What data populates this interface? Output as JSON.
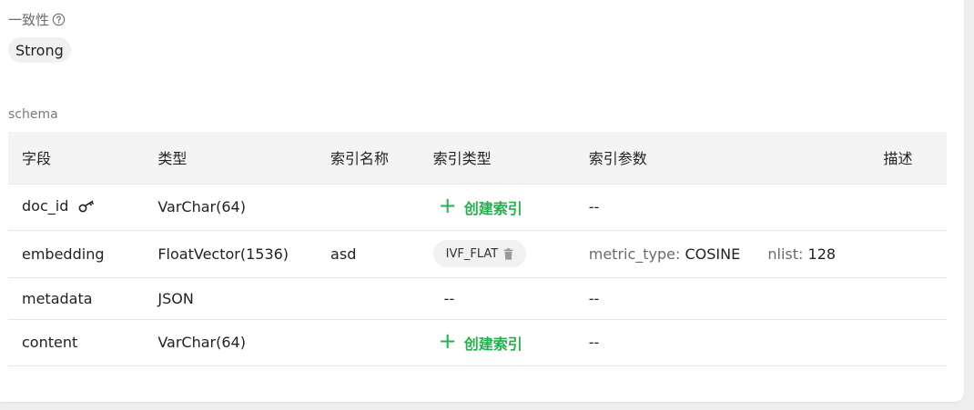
{
  "consistency": {
    "label": "一致性",
    "value": "Strong"
  },
  "schema": {
    "label": "schema",
    "headers": [
      "字段",
      "类型",
      "索引名称",
      "索引类型",
      "索引参数",
      "描述"
    ],
    "rows": [
      {
        "field": "doc_id",
        "type": "VarChar(64)",
        "index_name": "",
        "index_type": "",
        "create_index_label": "创建索引",
        "index_params": "--",
        "primary_key": true
      },
      {
        "field": "embedding",
        "type": "FloatVector(1536)",
        "index_name": "asd",
        "index_type": "IVF_FLAT",
        "params": [
          {
            "key": "metric_type:",
            "value": "COSINE"
          },
          {
            "key": "nlist:",
            "value": "128"
          }
        ]
      },
      {
        "field": "metadata",
        "type": "JSON",
        "index_name": "",
        "index_type": "--",
        "index_params": "--"
      },
      {
        "field": "content",
        "type": "VarChar(64)",
        "index_name": "",
        "create_index_label": "创建索引",
        "index_params": "--"
      }
    ]
  },
  "colors": {
    "accent": "#22b14c"
  },
  "icons": {
    "help": "help-circle-icon",
    "key": "key-icon",
    "plus": "plus-icon",
    "trash": "trash-icon"
  }
}
